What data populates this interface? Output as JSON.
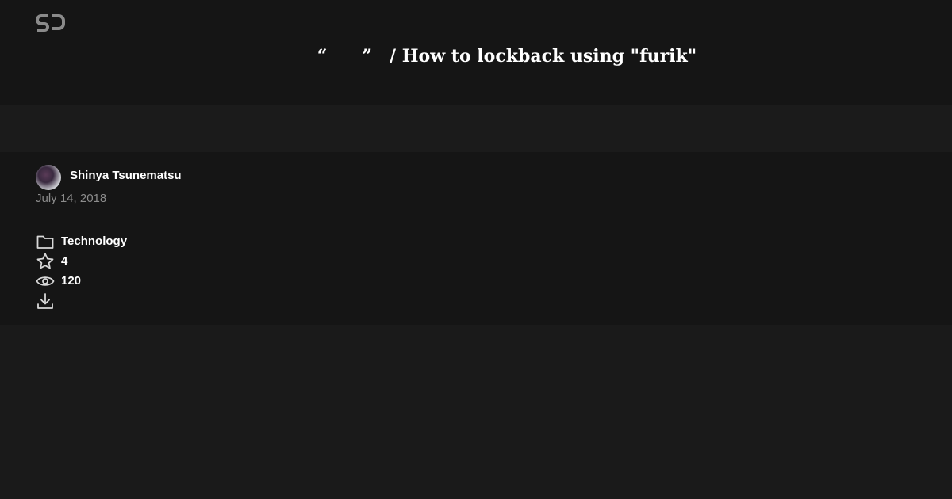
{
  "header": {
    "logo_text": "SD",
    "title": "“　　”　/ How to lockback using \"furik\""
  },
  "author": {
    "name": "Shinya Tsunematsu",
    "date": "July 14, 2018"
  },
  "stats": {
    "category": "Technology",
    "stars": "4",
    "views": "120"
  },
  "colors": {
    "background": "#1a1a1a",
    "header_bg": "#151515",
    "muted_text": "#8c8c8c",
    "logo": "#8a8a8a"
  },
  "icons": {
    "logo": "speakerdeck-logo",
    "category": "folder-icon",
    "stars": "star-icon",
    "views": "eye-icon",
    "download": "download-icon"
  }
}
